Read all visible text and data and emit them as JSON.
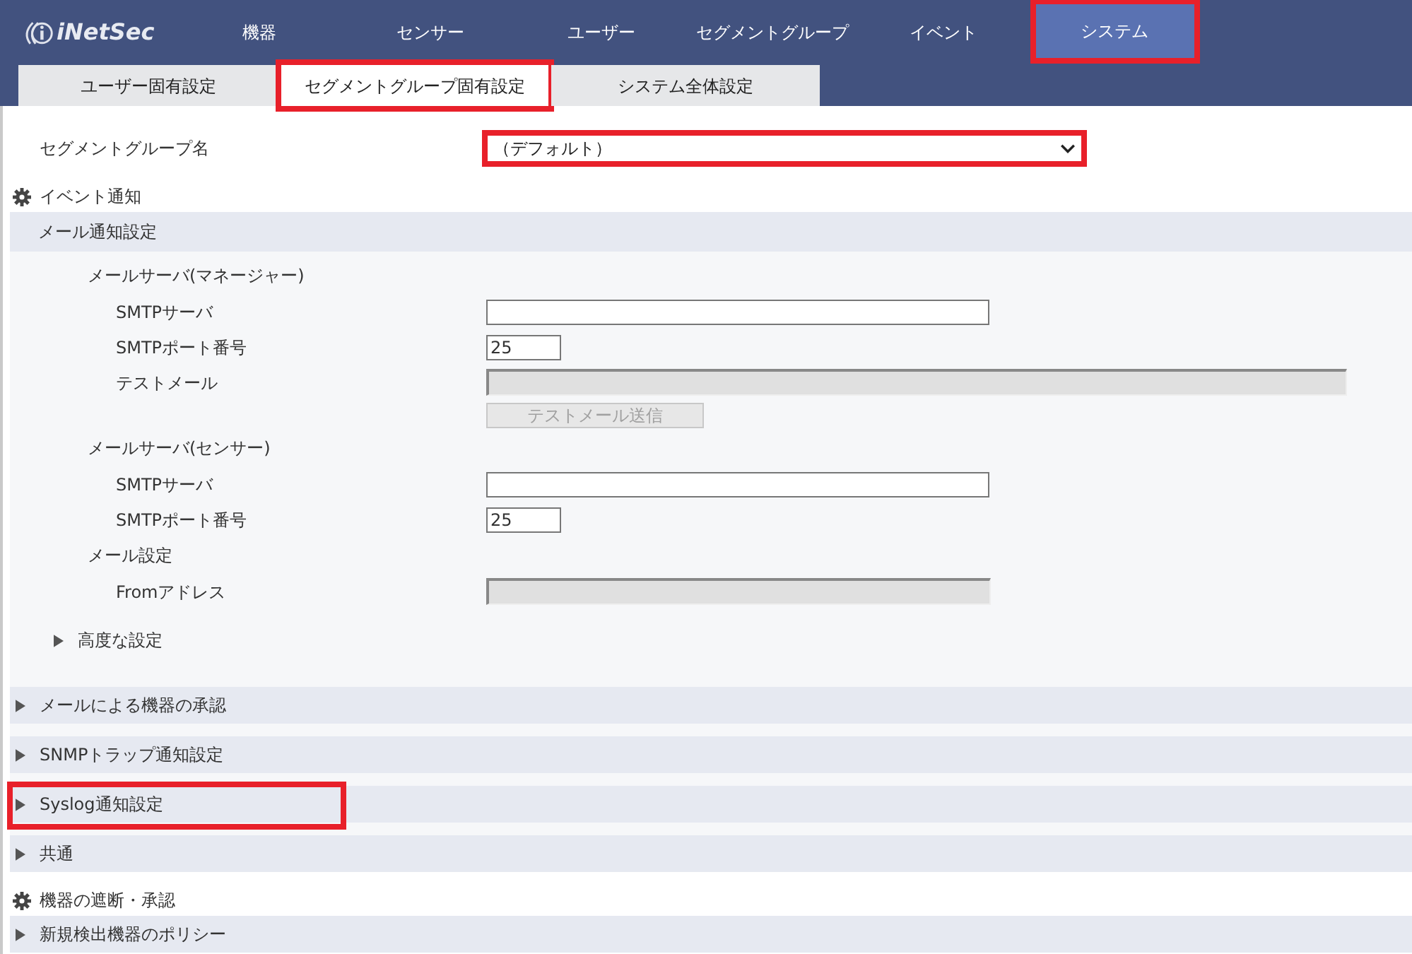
{
  "logo": {
    "text": "iNetSec"
  },
  "nav": [
    {
      "label": "機器",
      "selected": false,
      "highlighted": false
    },
    {
      "label": "センサー",
      "selected": false,
      "highlighted": false
    },
    {
      "label": "ユーザー",
      "selected": false,
      "highlighted": false
    },
    {
      "label": "セグメントグループ",
      "selected": false,
      "highlighted": false
    },
    {
      "label": "イベント",
      "selected": false,
      "highlighted": false
    },
    {
      "label": "システム",
      "selected": true,
      "highlighted": true
    }
  ],
  "subtabs": [
    {
      "label": "ユーザー固有設定",
      "selected": false,
      "highlighted": false
    },
    {
      "label": "セグメントグループ固有設定",
      "selected": true,
      "highlighted": true
    },
    {
      "label": "システム全体設定",
      "selected": false,
      "highlighted": false
    }
  ],
  "segment_group": {
    "label": "セグメントグループ名",
    "value": "（デフォルト）",
    "highlighted": true
  },
  "groups": [
    {
      "title": "イベント通知",
      "sections": [
        {
          "title": "メール通知設定",
          "expanded": true,
          "highlighted": false,
          "items": [
            {
              "kind": "heading",
              "label": "メールサーバ(マネージャー)"
            },
            {
              "kind": "text",
              "label": "SMTPサーバ"
            },
            {
              "kind": "number",
              "label": "SMTPポート番号",
              "value": "25"
            },
            {
              "kind": "readonly-wide",
              "label": "テストメール"
            },
            {
              "kind": "button",
              "label": "テストメール送信",
              "disabled": true
            },
            {
              "kind": "heading",
              "label": "メールサーバ(センサー)"
            },
            {
              "kind": "text",
              "label": "SMTPサーバ"
            },
            {
              "kind": "number",
              "label": "SMTPポート番号",
              "value": "25"
            },
            {
              "kind": "heading",
              "label": "メール設定"
            },
            {
              "kind": "readonly",
              "label": "Fromアドレス"
            },
            {
              "kind": "subsection",
              "label": "高度な設定",
              "expanded": false
            }
          ]
        },
        {
          "title": "メールによる機器の承認",
          "expanded": false,
          "highlighted": false
        },
        {
          "title": "SNMPトラップ通知設定",
          "expanded": false,
          "highlighted": false
        },
        {
          "title": "Syslog通知設定",
          "expanded": false,
          "highlighted": true
        },
        {
          "title": "共通",
          "expanded": false,
          "highlighted": false
        }
      ]
    },
    {
      "title": "機器の遮断・承認",
      "sections": [
        {
          "title": "新規検出機器のポリシー",
          "expanded": false,
          "highlighted": false
        }
      ]
    }
  ]
}
